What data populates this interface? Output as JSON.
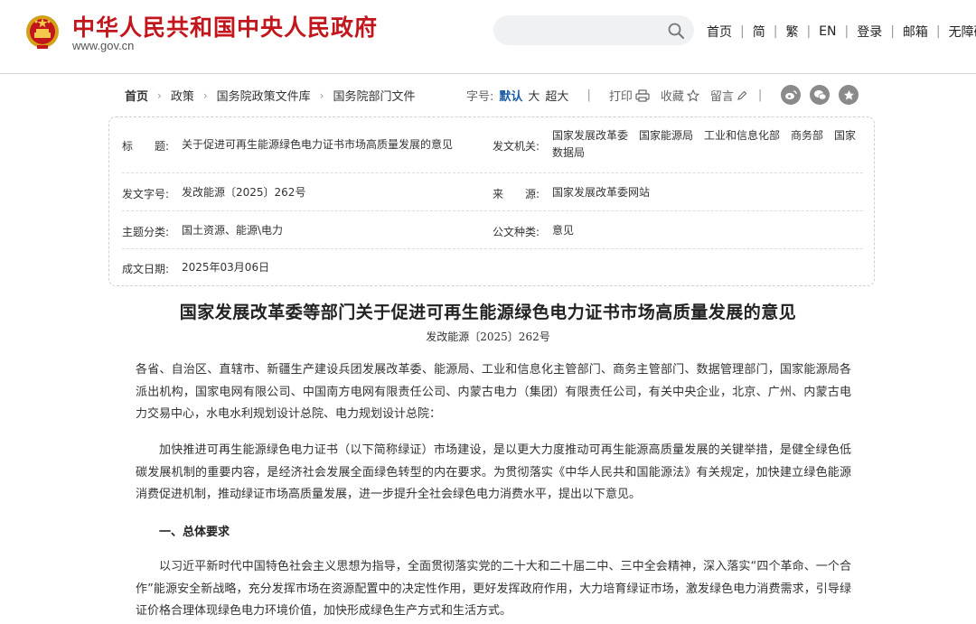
{
  "header": {
    "site_name": "中华人民共和国中央人民政府",
    "site_url": "www.gov.cn",
    "search_placeholder": "",
    "nav": [
      "首页",
      "简",
      "繁",
      "EN",
      "登录",
      "邮箱",
      "无障碍"
    ],
    "brand_color": "#c2161c"
  },
  "breadcrumb": [
    "首页",
    "政策",
    "国务院政策文件库",
    "国务院部门文件"
  ],
  "tools": {
    "font_label": "字号:",
    "font_sizes": [
      "默认",
      "大",
      "超大"
    ],
    "print_label": "打印",
    "favorite_label": "收藏",
    "comment_label": "留言",
    "share_icons": [
      "weibo-icon",
      "wechat-icon",
      "star-icon"
    ]
  },
  "info": {
    "title_label": "标　　题:",
    "title_value": "关于促进可再生能源绿色电力证书市场高质量发展的意见",
    "issuer_label": "发文机关:",
    "issuer_value": "国家发展改革委　国家能源局　工业和信息化部　商务部　国家数据局",
    "docno_label": "发文字号:",
    "docno_value": "发改能源〔2025〕262号",
    "source_label": "来　　源:",
    "source_value": "国家发展改革委网站",
    "topic_label": "主题分类:",
    "topic_value": "国土资源、能源\\电力",
    "type_label": "公文种类:",
    "type_value": "意见",
    "date_label": "成文日期:",
    "date_value": "2025年03月06日"
  },
  "article": {
    "title": "国家发展改革委等部门关于促进可再生能源绿色电力证书市场高质量发展的意见",
    "doc_no": "发改能源〔2025〕262号",
    "recipients": "各省、自治区、直辖市、新疆生产建设兵团发展改革委、能源局、工业和信息化主管部门、商务主管部门、数据管理部门，国家能源局各派出机构，国家电网有限公司、中国南方电网有限责任公司、内蒙古电力（集团）有限责任公司，有关中央企业，北京、广州、内蒙古电力交易中心，水电水利规划设计总院、电力规划设计总院：",
    "para1": "加快推进可再生能源绿色电力证书（以下简称绿证）市场建设，是以更大力度推动可再生能源高质量发展的关键举措，是健全绿色低碳发展机制的重要内容，是经济社会发展全面绿色转型的内在要求。为贯彻落实《中华人民共和国能源法》有关规定，加快建立绿色能源消费促进机制，推动绿证市场高质量发展，进一步提升全社会绿色电力消费水平，提出以下意见。",
    "heading1": "一、总体要求",
    "para2": "以习近平新时代中国特色社会主义思想为指导，全面贯彻落实党的二十大和二十届二中、三中全会精神，深入落实“四个革命、一个合作”能源安全新战略，充分发挥市场在资源配置中的决定性作用，更好发挥政府作用，大力培育绿证市场，激发绿色电力消费需求，引导绿证价格合理体现绿色电力环境价值，加快形成绿色生产方式和生活方式。"
  }
}
